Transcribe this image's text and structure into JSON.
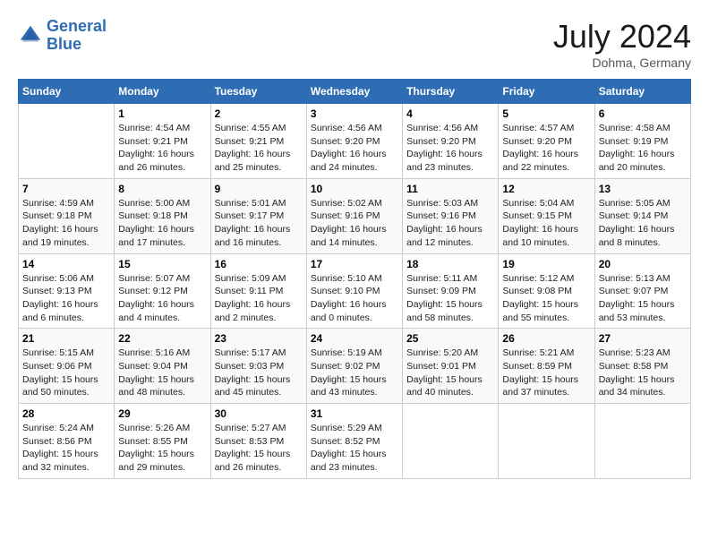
{
  "header": {
    "logo_line1": "General",
    "logo_line2": "Blue",
    "month_year": "July 2024",
    "location": "Dohma, Germany"
  },
  "weekdays": [
    "Sunday",
    "Monday",
    "Tuesday",
    "Wednesday",
    "Thursday",
    "Friday",
    "Saturday"
  ],
  "weeks": [
    [
      {
        "day": "",
        "empty": true
      },
      {
        "day": "1",
        "sunrise": "Sunrise: 4:54 AM",
        "sunset": "Sunset: 9:21 PM",
        "daylight": "Daylight: 16 hours and 26 minutes."
      },
      {
        "day": "2",
        "sunrise": "Sunrise: 4:55 AM",
        "sunset": "Sunset: 9:21 PM",
        "daylight": "Daylight: 16 hours and 25 minutes."
      },
      {
        "day": "3",
        "sunrise": "Sunrise: 4:56 AM",
        "sunset": "Sunset: 9:20 PM",
        "daylight": "Daylight: 16 hours and 24 minutes."
      },
      {
        "day": "4",
        "sunrise": "Sunrise: 4:56 AM",
        "sunset": "Sunset: 9:20 PM",
        "daylight": "Daylight: 16 hours and 23 minutes."
      },
      {
        "day": "5",
        "sunrise": "Sunrise: 4:57 AM",
        "sunset": "Sunset: 9:20 PM",
        "daylight": "Daylight: 16 hours and 22 minutes."
      },
      {
        "day": "6",
        "sunrise": "Sunrise: 4:58 AM",
        "sunset": "Sunset: 9:19 PM",
        "daylight": "Daylight: 16 hours and 20 minutes."
      }
    ],
    [
      {
        "day": "7",
        "sunrise": "Sunrise: 4:59 AM",
        "sunset": "Sunset: 9:18 PM",
        "daylight": "Daylight: 16 hours and 19 minutes."
      },
      {
        "day": "8",
        "sunrise": "Sunrise: 5:00 AM",
        "sunset": "Sunset: 9:18 PM",
        "daylight": "Daylight: 16 hours and 17 minutes."
      },
      {
        "day": "9",
        "sunrise": "Sunrise: 5:01 AM",
        "sunset": "Sunset: 9:17 PM",
        "daylight": "Daylight: 16 hours and 16 minutes."
      },
      {
        "day": "10",
        "sunrise": "Sunrise: 5:02 AM",
        "sunset": "Sunset: 9:16 PM",
        "daylight": "Daylight: 16 hours and 14 minutes."
      },
      {
        "day": "11",
        "sunrise": "Sunrise: 5:03 AM",
        "sunset": "Sunset: 9:16 PM",
        "daylight": "Daylight: 16 hours and 12 minutes."
      },
      {
        "day": "12",
        "sunrise": "Sunrise: 5:04 AM",
        "sunset": "Sunset: 9:15 PM",
        "daylight": "Daylight: 16 hours and 10 minutes."
      },
      {
        "day": "13",
        "sunrise": "Sunrise: 5:05 AM",
        "sunset": "Sunset: 9:14 PM",
        "daylight": "Daylight: 16 hours and 8 minutes."
      }
    ],
    [
      {
        "day": "14",
        "sunrise": "Sunrise: 5:06 AM",
        "sunset": "Sunset: 9:13 PM",
        "daylight": "Daylight: 16 hours and 6 minutes."
      },
      {
        "day": "15",
        "sunrise": "Sunrise: 5:07 AM",
        "sunset": "Sunset: 9:12 PM",
        "daylight": "Daylight: 16 hours and 4 minutes."
      },
      {
        "day": "16",
        "sunrise": "Sunrise: 5:09 AM",
        "sunset": "Sunset: 9:11 PM",
        "daylight": "Daylight: 16 hours and 2 minutes."
      },
      {
        "day": "17",
        "sunrise": "Sunrise: 5:10 AM",
        "sunset": "Sunset: 9:10 PM",
        "daylight": "Daylight: 16 hours and 0 minutes."
      },
      {
        "day": "18",
        "sunrise": "Sunrise: 5:11 AM",
        "sunset": "Sunset: 9:09 PM",
        "daylight": "Daylight: 15 hours and 58 minutes."
      },
      {
        "day": "19",
        "sunrise": "Sunrise: 5:12 AM",
        "sunset": "Sunset: 9:08 PM",
        "daylight": "Daylight: 15 hours and 55 minutes."
      },
      {
        "day": "20",
        "sunrise": "Sunrise: 5:13 AM",
        "sunset": "Sunset: 9:07 PM",
        "daylight": "Daylight: 15 hours and 53 minutes."
      }
    ],
    [
      {
        "day": "21",
        "sunrise": "Sunrise: 5:15 AM",
        "sunset": "Sunset: 9:06 PM",
        "daylight": "Daylight: 15 hours and 50 minutes."
      },
      {
        "day": "22",
        "sunrise": "Sunrise: 5:16 AM",
        "sunset": "Sunset: 9:04 PM",
        "daylight": "Daylight: 15 hours and 48 minutes."
      },
      {
        "day": "23",
        "sunrise": "Sunrise: 5:17 AM",
        "sunset": "Sunset: 9:03 PM",
        "daylight": "Daylight: 15 hours and 45 minutes."
      },
      {
        "day": "24",
        "sunrise": "Sunrise: 5:19 AM",
        "sunset": "Sunset: 9:02 PM",
        "daylight": "Daylight: 15 hours and 43 minutes."
      },
      {
        "day": "25",
        "sunrise": "Sunrise: 5:20 AM",
        "sunset": "Sunset: 9:01 PM",
        "daylight": "Daylight: 15 hours and 40 minutes."
      },
      {
        "day": "26",
        "sunrise": "Sunrise: 5:21 AM",
        "sunset": "Sunset: 8:59 PM",
        "daylight": "Daylight: 15 hours and 37 minutes."
      },
      {
        "day": "27",
        "sunrise": "Sunrise: 5:23 AM",
        "sunset": "Sunset: 8:58 PM",
        "daylight": "Daylight: 15 hours and 34 minutes."
      }
    ],
    [
      {
        "day": "28",
        "sunrise": "Sunrise: 5:24 AM",
        "sunset": "Sunset: 8:56 PM",
        "daylight": "Daylight: 15 hours and 32 minutes."
      },
      {
        "day": "29",
        "sunrise": "Sunrise: 5:26 AM",
        "sunset": "Sunset: 8:55 PM",
        "daylight": "Daylight: 15 hours and 29 minutes."
      },
      {
        "day": "30",
        "sunrise": "Sunrise: 5:27 AM",
        "sunset": "Sunset: 8:53 PM",
        "daylight": "Daylight: 15 hours and 26 minutes."
      },
      {
        "day": "31",
        "sunrise": "Sunrise: 5:29 AM",
        "sunset": "Sunset: 8:52 PM",
        "daylight": "Daylight: 15 hours and 23 minutes."
      },
      {
        "day": "",
        "empty": true
      },
      {
        "day": "",
        "empty": true
      },
      {
        "day": "",
        "empty": true
      }
    ]
  ]
}
